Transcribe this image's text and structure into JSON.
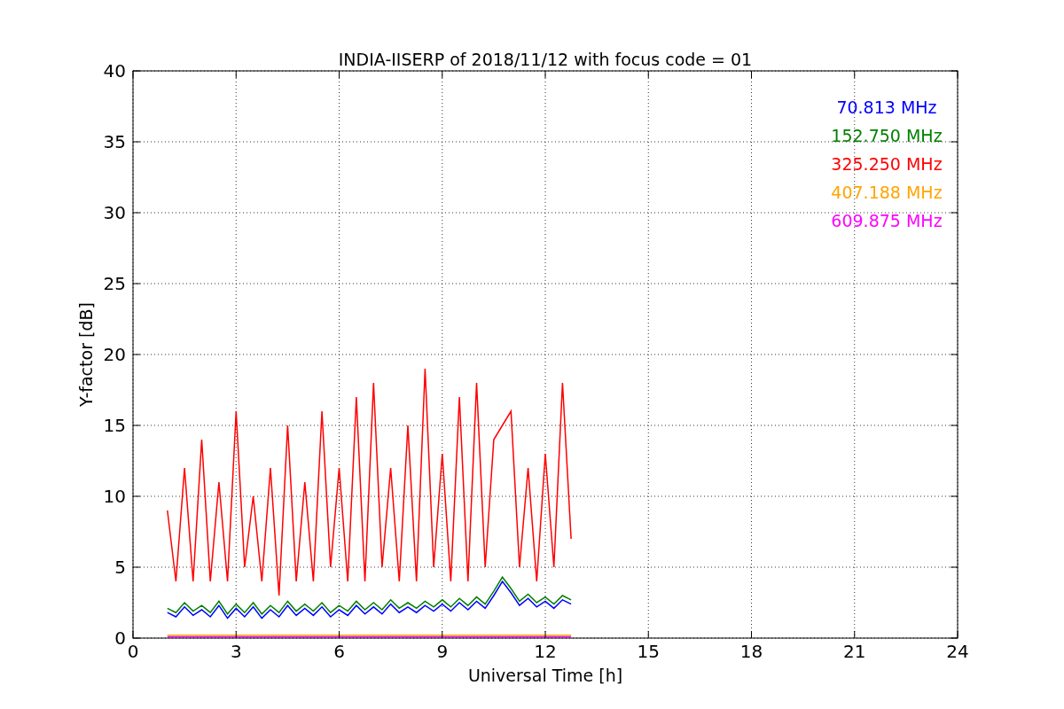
{
  "figure": {
    "chart_data": {
      "type": "line",
      "title": "INDIA-IISERP of 2018/11/12 with focus code = 01",
      "xlabel": "Universal Time [h]",
      "ylabel": "Y-factor [dB]",
      "xlim": [
        0,
        24
      ],
      "ylim": [
        0,
        40
      ],
      "xticks": [
        0,
        3,
        6,
        9,
        12,
        15,
        18,
        21,
        24
      ],
      "yticks": [
        0,
        5,
        10,
        15,
        20,
        25,
        30,
        35,
        40
      ],
      "grid": true,
      "x": [
        1,
        1.25,
        1.5,
        1.75,
        2,
        2.25,
        2.5,
        2.75,
        3,
        3.25,
        3.5,
        3.75,
        4,
        4.25,
        4.5,
        4.75,
        5,
        5.25,
        5.5,
        5.75,
        6,
        6.25,
        6.5,
        6.75,
        7,
        7.25,
        7.5,
        7.75,
        8,
        8.25,
        8.5,
        8.75,
        9,
        9.25,
        9.5,
        9.75,
        10,
        10.25,
        10.5,
        10.75,
        11,
        11.25,
        11.5,
        11.75,
        12,
        12.25,
        12.5,
        12.75
      ],
      "series": [
        {
          "name": "70.813 MHz",
          "color": "#0000ff",
          "values": [
            1.8,
            1.5,
            2.2,
            1.6,
            2.0,
            1.5,
            2.3,
            1.4,
            2.1,
            1.5,
            2.2,
            1.4,
            2.0,
            1.5,
            2.3,
            1.6,
            2.1,
            1.6,
            2.2,
            1.5,
            2.0,
            1.6,
            2.3,
            1.7,
            2.2,
            1.7,
            2.4,
            1.8,
            2.2,
            1.8,
            2.3,
            1.9,
            2.4,
            1.9,
            2.5,
            2.0,
            2.6,
            2.1,
            3.0,
            4.0,
            3.2,
            2.3,
            2.8,
            2.2,
            2.6,
            2.1,
            2.7,
            2.4
          ]
        },
        {
          "name": "152.750 MHz",
          "color": "#008000",
          "values": [
            2.1,
            1.8,
            2.5,
            1.9,
            2.3,
            1.8,
            2.6,
            1.7,
            2.4,
            1.8,
            2.5,
            1.7,
            2.3,
            1.8,
            2.6,
            1.9,
            2.4,
            1.9,
            2.5,
            1.8,
            2.3,
            1.9,
            2.6,
            2.0,
            2.5,
            2.0,
            2.7,
            2.1,
            2.5,
            2.1,
            2.6,
            2.2,
            2.7,
            2.2,
            2.8,
            2.3,
            2.9,
            2.4,
            3.3,
            4.3,
            3.5,
            2.6,
            3.1,
            2.5,
            2.9,
            2.4,
            3.0,
            2.7
          ]
        },
        {
          "name": "325.250 MHz",
          "color": "#ff0000",
          "values": [
            9,
            4,
            12,
            4,
            14,
            4,
            11,
            4,
            16,
            5,
            10,
            4,
            12,
            3,
            15,
            4,
            11,
            4,
            16,
            5,
            12,
            4,
            17,
            4,
            18,
            5,
            12,
            4,
            15,
            4,
            19,
            5,
            13,
            4,
            17,
            4,
            18,
            5,
            14,
            15,
            16,
            5,
            12,
            4,
            13,
            5,
            18,
            7
          ]
        },
        {
          "name": "407.188 MHz",
          "color": "#ffa500",
          "values": [
            0.2,
            0.2,
            0.2,
            0.2,
            0.2,
            0.2,
            0.2,
            0.2,
            0.2,
            0.2,
            0.2,
            0.2,
            0.2,
            0.2,
            0.2,
            0.2,
            0.2,
            0.2,
            0.2,
            0.2,
            0.2,
            0.2,
            0.2,
            0.2,
            0.2,
            0.2,
            0.2,
            0.2,
            0.2,
            0.2,
            0.2,
            0.2,
            0.2,
            0.2,
            0.2,
            0.2,
            0.2,
            0.2,
            0.2,
            0.2,
            0.2,
            0.2,
            0.2,
            0.2,
            0.2,
            0.2,
            0.2,
            0.2
          ]
        },
        {
          "name": "609.875 MHz",
          "color": "#ff00ff",
          "values": [
            0.1,
            0.1,
            0.1,
            0.1,
            0.1,
            0.1,
            0.1,
            0.1,
            0.1,
            0.1,
            0.1,
            0.1,
            0.1,
            0.1,
            0.1,
            0.1,
            0.1,
            0.1,
            0.1,
            0.1,
            0.1,
            0.1,
            0.1,
            0.1,
            0.1,
            0.1,
            0.1,
            0.1,
            0.1,
            0.1,
            0.1,
            0.1,
            0.1,
            0.1,
            0.1,
            0.1,
            0.1,
            0.1,
            0.1,
            0.1,
            0.1,
            0.1,
            0.1,
            0.1,
            0.1,
            0.1,
            0.1,
            0.1
          ]
        }
      ]
    }
  }
}
